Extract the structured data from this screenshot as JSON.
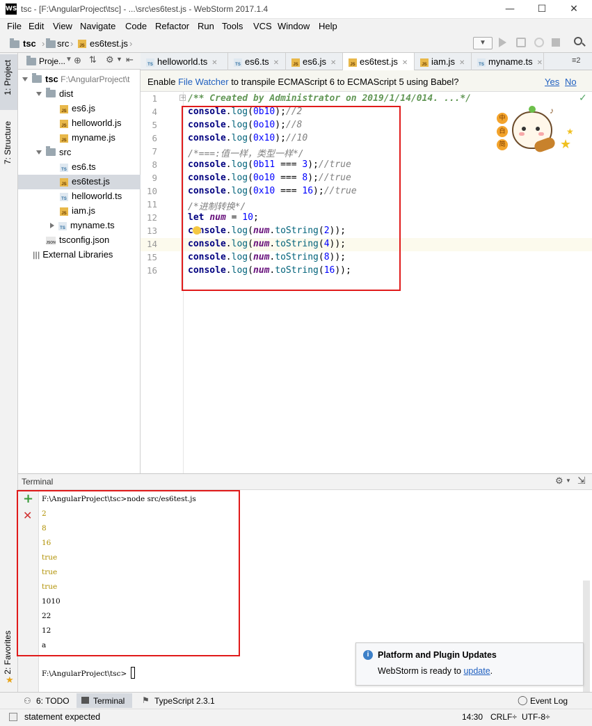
{
  "window": {
    "title": "tsc - [F:\\AngularProject\\tsc] - ...\\src\\es6test.js - WebStorm 2017.1.4",
    "logo": "WS",
    "minimize": "—",
    "maximize": "☐",
    "close": "✕"
  },
  "menu": [
    "File",
    "Edit",
    "View",
    "Navigate",
    "Code",
    "Refactor",
    "Run",
    "Tools",
    "VCS",
    "Window",
    "Help"
  ],
  "breadcrumb": {
    "root": "tsc",
    "folder": "src",
    "file": "es6test.js"
  },
  "left_strip": {
    "project": "1: Project",
    "structure": "7: Structure",
    "favorites": "2: Favorites"
  },
  "project_panel": {
    "header": "Proje...",
    "tree": [
      {
        "label": "tsc",
        "path": "F:\\AngularProject\\t",
        "kind": "root",
        "indent": 0,
        "arrow": "down"
      },
      {
        "label": "dist",
        "kind": "folder",
        "indent": 1,
        "arrow": "down"
      },
      {
        "label": "es6.js",
        "kind": "js",
        "indent": 2
      },
      {
        "label": "helloworld.js",
        "kind": "js",
        "indent": 2
      },
      {
        "label": "myname.js",
        "kind": "js",
        "indent": 2
      },
      {
        "label": "src",
        "kind": "folder",
        "indent": 1,
        "arrow": "down"
      },
      {
        "label": "es6.ts",
        "kind": "ts",
        "indent": 2
      },
      {
        "label": "es6test.js",
        "kind": "js",
        "indent": 2,
        "selected": true
      },
      {
        "label": "helloworld.ts",
        "kind": "ts",
        "indent": 2
      },
      {
        "label": "iam.js",
        "kind": "js",
        "indent": 2
      },
      {
        "label": "myname.ts",
        "kind": "ts",
        "indent": 2,
        "arrow": "right"
      },
      {
        "label": "tsconfig.json",
        "kind": "json",
        "indent": 1
      },
      {
        "label": "External Libraries",
        "kind": "lib",
        "indent": 0
      }
    ]
  },
  "editor_tabs": [
    {
      "label": "helloworld.ts",
      "kind": "ts"
    },
    {
      "label": "es6.ts",
      "kind": "ts"
    },
    {
      "label": "es6.js",
      "kind": "js"
    },
    {
      "label": "es6test.js",
      "kind": "js",
      "active": true
    },
    {
      "label": "iam.js",
      "kind": "js"
    },
    {
      "label": "myname.ts",
      "kind": "ts"
    }
  ],
  "tabs_overflow": "≡2",
  "infobar": {
    "prefix": "Enable ",
    "link": "File Watcher",
    "suffix": " to transpile ECMAScript 6 to ECMAScript 5 using Babel?",
    "yes": "Yes",
    "no": "No"
  },
  "code_lines": [
    {
      "n": "1",
      "text": "/** Created by Administrator on 2019/1/14/014. ...*/"
    },
    {
      "n": "4",
      "text": "console.log(0b10);//2"
    },
    {
      "n": "5",
      "text": "console.log(0o10);//8"
    },
    {
      "n": "6",
      "text": "console.log(0x10);//10"
    },
    {
      "n": "7",
      "text": "/*===:值一样，类型一样*/"
    },
    {
      "n": "8",
      "text": "console.log(0b11 === 3);//true"
    },
    {
      "n": "9",
      "text": "console.log(0o10 === 8);//true"
    },
    {
      "n": "10",
      "text": "console.log(0x10 === 16);//true"
    },
    {
      "n": "11",
      "text": "/*进制转换*/"
    },
    {
      "n": "12",
      "text": "let num = 10;"
    },
    {
      "n": "13",
      "text": "console.log(num.toString(2));"
    },
    {
      "n": "14",
      "text": "console.log(num.toString(4));"
    },
    {
      "n": "15",
      "text": "console.log(num.toString(8));"
    },
    {
      "n": "16",
      "text": "console.log(num.toString(16));"
    }
  ],
  "sticker_text": [
    "中",
    "白",
    "简"
  ],
  "terminal": {
    "title": "Terminal",
    "lines": [
      {
        "text": "F:\\AngularProject\\tsc>node src/es6test.js",
        "color": "default"
      },
      {
        "text": "2",
        "color": "yellow"
      },
      {
        "text": "8",
        "color": "yellow"
      },
      {
        "text": "16",
        "color": "yellow"
      },
      {
        "text": "true",
        "color": "yellow"
      },
      {
        "text": "true",
        "color": "yellow"
      },
      {
        "text": "true",
        "color": "yellow"
      },
      {
        "text": "1010",
        "color": "default"
      },
      {
        "text": "22",
        "color": "default"
      },
      {
        "text": "12",
        "color": "default"
      },
      {
        "text": "a",
        "color": "default"
      }
    ],
    "prompt": "F:\\AngularProject\\tsc>"
  },
  "notification": {
    "title": "Platform and Plugin Updates",
    "body": "WebStorm is ready to ",
    "link": "update",
    "end": "."
  },
  "bottom_tools": {
    "todo": "6: TODO",
    "terminal": "Terminal",
    "typescript": "TypeScript 2.3.1",
    "eventlog": "Event Log"
  },
  "status": {
    "message": "statement expected",
    "position": "14:30",
    "line_sep": "CRLF÷",
    "encoding": "UTF-8÷"
  },
  "colors": {
    "redbox": "#e01a1a",
    "keyword": "#000080",
    "number": "#0000ff",
    "comment": "#808080",
    "doc": "#629755"
  }
}
